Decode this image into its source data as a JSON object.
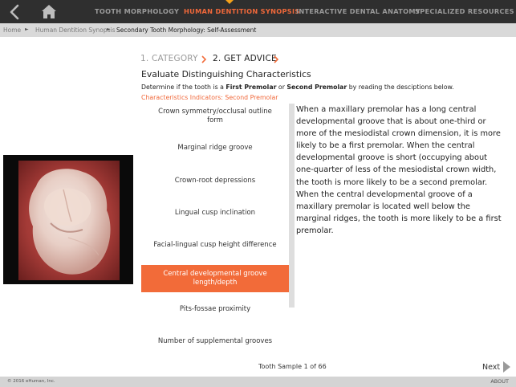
{
  "nav": {
    "tabs": [
      {
        "label": "TOOTH MORPHOLOGY"
      },
      {
        "label": "HUMAN DENTITION SYNOPSIS"
      },
      {
        "label": "INTERACTIVE DENTAL ANATOMY"
      },
      {
        "label": "SPECIALIZED RESOURCES"
      }
    ],
    "active_tab": "HUMAN DENTITION SYNOPSIS",
    "back_icon": "chevron-left-icon",
    "home_icon": "home-icon"
  },
  "breadcrumb": [
    "Home",
    "Human Dentition Synopsis",
    "Secondary Tooth Morphology: Self-Assessment"
  ],
  "steps": [
    {
      "label": "1. CATEGORY"
    },
    {
      "label": "2. GET ADVICE"
    }
  ],
  "heading": "Evaluate Distinguishing Characteristics",
  "instructions": {
    "prefix": "Determine if the tooth is a ",
    "option1": "First Premolar",
    "middle": " or ",
    "option2": "Second Premolar",
    "suffix": " by reading the desciptions below."
  },
  "indicator_label": "Characteristics Indicators: Second Premolar",
  "characteristics": [
    "Crown symmetry/occlusal outline form",
    "Marginal ridge groove",
    "Crown-root depressions",
    "Lingual cusp inclination",
    "Facial-lingual cusp height difference",
    "Central developmental groove length/depth",
    "Pits-fossae proximity",
    "Number of supplemental grooves"
  ],
  "selected_characteristic": "Central developmental groove length/depth",
  "description": "When a maxillary premolar has a long central developmental groove that is about one-third or more of the mesiodistal crown dimension, it is more likely to be a first premolar. When the central developmental groove is short (occupying about one-quarter of less of the mesiodistal crown width, the tooth is more likely to be a second premolar. When the central developmental groove of a maxillary premolar is located well below the marginal ridges, the tooth is more likely to be a first premolar.",
  "sample_label": "Tooth Sample 1 of 66",
  "next_label": "Next",
  "footer": {
    "copyright": "© 2016 eHuman, Inc.",
    "about": "ABOUT"
  },
  "colors": {
    "accent": "#f26b39",
    "nav_bg": "#2f2f2f",
    "caret": "#f4a21b"
  }
}
